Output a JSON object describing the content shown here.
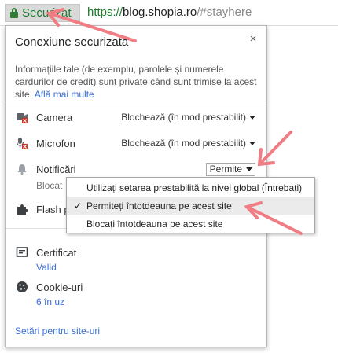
{
  "addressbar": {
    "secure_label": "Securizat",
    "url_scheme": "https://",
    "url_host": "blog.shopia.ro",
    "url_path": "/#stayhere"
  },
  "popup": {
    "title": "Conexiune securizată",
    "close_label": "×",
    "description": "Informațiile tale (de exemplu, parolele și numerele cardurilor de credit) sunt private când sunt trimise la acest site.",
    "learn_more": "Află mai multe",
    "permissions": {
      "camera": {
        "label": "Camera",
        "value": "Blochează (în mod prestabilit)"
      },
      "microphone": {
        "label": "Microfon",
        "value": "Blochează (în mod prestabilit)"
      },
      "notifications": {
        "label": "Notificări",
        "value": "Permite",
        "status": "Blocat"
      },
      "flash": {
        "label": "Flash p"
      }
    },
    "certificate": {
      "label": "Certificat",
      "value": "Valid"
    },
    "cookies": {
      "label": "Cookie-uri",
      "value": "6 în uz"
    },
    "site_settings": "Setări pentru site-uri"
  },
  "menu": {
    "items": [
      {
        "label": "Utilizați setarea prestabilită la nivel global (Întrebați)",
        "checked": false
      },
      {
        "label": "Permiteți întotdeauna pe acest site",
        "checked": true
      },
      {
        "label": "Blocați întotdeauna pe acest site",
        "checked": false
      }
    ],
    "check_mark": "✓"
  },
  "colors": {
    "secure_green": "#1e7b2c",
    "link_blue": "#3a6fd8",
    "annotation_arrow": "#f07c84"
  }
}
